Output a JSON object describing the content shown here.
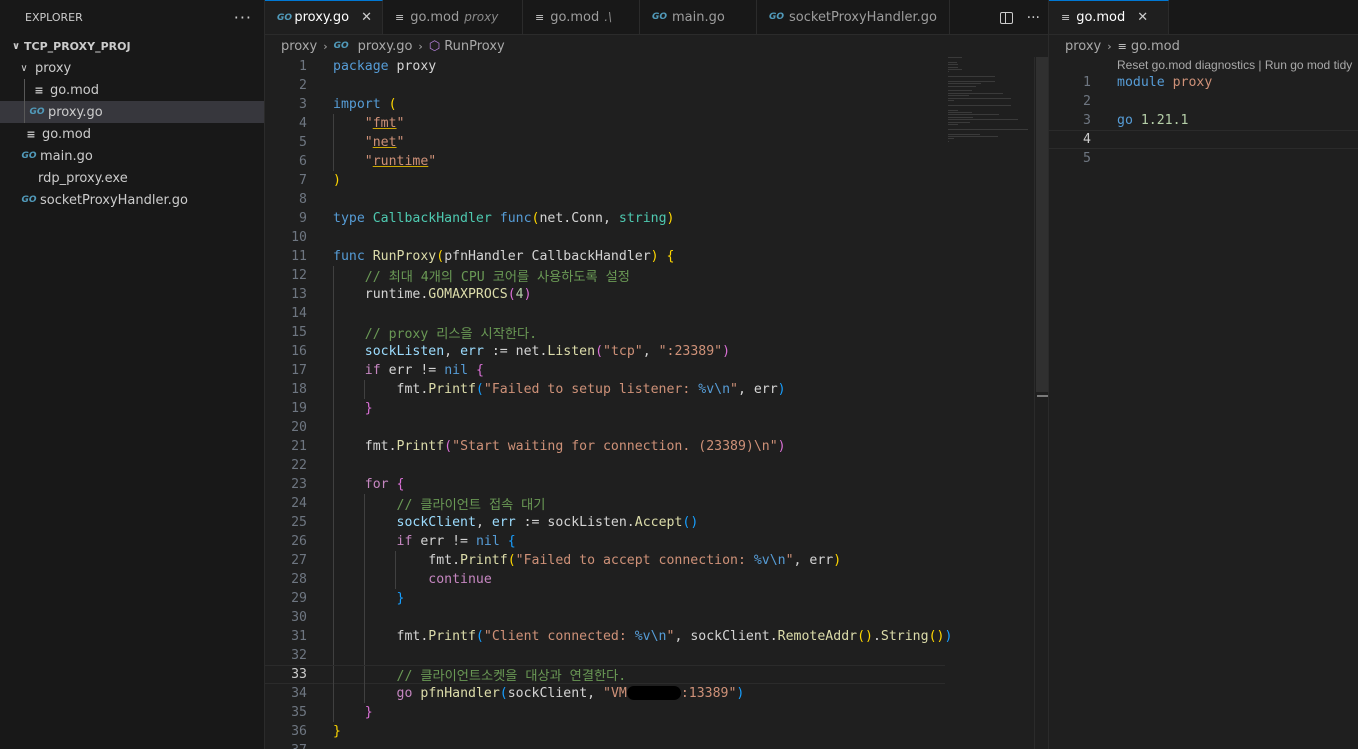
{
  "explorer": {
    "title": "EXPLORER",
    "more": "···",
    "root": "TCP_PROXY_PROJ",
    "items": [
      {
        "label": "proxy",
        "kind": "folder"
      },
      {
        "label": "go.mod",
        "kind": "mod"
      },
      {
        "label": "proxy.go",
        "kind": "go"
      },
      {
        "label": "go.mod",
        "kind": "mod"
      },
      {
        "label": "main.go",
        "kind": "go"
      },
      {
        "label": "rdp_proxy.exe",
        "kind": "exe"
      },
      {
        "label": "socketProxyHandler.go",
        "kind": "go"
      }
    ]
  },
  "tabs": [
    {
      "label": "proxy.go",
      "desc": "",
      "close": "✕"
    },
    {
      "label": "go.mod",
      "desc": "proxy"
    },
    {
      "label": "go.mod",
      "desc": ".\\"
    },
    {
      "label": "main.go",
      "desc": ""
    },
    {
      "label": "socketProxyHandler.go",
      "desc": ""
    }
  ],
  "tab_actions": {
    "more": "···"
  },
  "breadcrumb": {
    "folder": "proxy",
    "file": "proxy.go",
    "symbol": "RunProxy"
  },
  "icons": {
    "go": "GO",
    "lines": "≡",
    "chev_open": "∨",
    "chev_right": "›",
    "symbol": "⬡"
  },
  "current_line": 33,
  "code_lines": [
    [
      [
        "kw",
        "package"
      ],
      [
        "pl",
        " proxy"
      ]
    ],
    [],
    [
      [
        "kw",
        "import"
      ],
      [
        "pl",
        " "
      ],
      [
        "br1",
        "("
      ]
    ],
    [
      [
        "pl",
        "    "
      ],
      [
        "str",
        "\""
      ],
      [
        "str squig",
        "fmt"
      ],
      [
        "str",
        "\""
      ]
    ],
    [
      [
        "pl",
        "    "
      ],
      [
        "str",
        "\""
      ],
      [
        "str squig",
        "net"
      ],
      [
        "str",
        "\""
      ]
    ],
    [
      [
        "pl",
        "    "
      ],
      [
        "str",
        "\""
      ],
      [
        "str squig",
        "runtime"
      ],
      [
        "str",
        "\""
      ]
    ],
    [
      [
        "br1",
        ")"
      ]
    ],
    [],
    [
      [
        "kw",
        "type"
      ],
      [
        "pl",
        " "
      ],
      [
        "ty",
        "CallbackHandler"
      ],
      [
        "pl",
        " "
      ],
      [
        "kw",
        "func"
      ],
      [
        "br1",
        "("
      ],
      [
        "pl",
        "net.Conn, "
      ],
      [
        "ty",
        "string"
      ],
      [
        "br1",
        ")"
      ]
    ],
    [],
    [
      [
        "kw",
        "func"
      ],
      [
        "pl",
        " "
      ],
      [
        "fn",
        "RunProxy"
      ],
      [
        "br1",
        "("
      ],
      [
        "pl",
        "pfnHandler CallbackHandler"
      ],
      [
        "br1",
        ")"
      ],
      [
        "pl",
        " "
      ],
      [
        "br1",
        "{"
      ]
    ],
    [
      [
        "pl",
        "    "
      ],
      [
        "cm",
        "// 최대 4개의 CPU 코어를 사용하도록 설정"
      ]
    ],
    [
      [
        "pl",
        "    runtime."
      ],
      [
        "fn",
        "GOMAXPROCS"
      ],
      [
        "br2",
        "("
      ],
      [
        "num",
        "4"
      ],
      [
        "br2",
        ")"
      ]
    ],
    [],
    [
      [
        "pl",
        "    "
      ],
      [
        "cm",
        "// proxy 리스을 시작한다."
      ]
    ],
    [
      [
        "pl",
        "    "
      ],
      [
        "var",
        "sockListen"
      ],
      [
        "pl",
        ", "
      ],
      [
        "var",
        "err"
      ],
      [
        "pl",
        " := net."
      ],
      [
        "fn",
        "Listen"
      ],
      [
        "br2",
        "("
      ],
      [
        "str",
        "\"tcp\""
      ],
      [
        "pl",
        ", "
      ],
      [
        "str",
        "\":23389\""
      ],
      [
        "br2",
        ")"
      ]
    ],
    [
      [
        "pl",
        "    "
      ],
      [
        "kw2",
        "if"
      ],
      [
        "pl",
        " err != "
      ],
      [
        "kw",
        "nil"
      ],
      [
        "pl",
        " "
      ],
      [
        "br2",
        "{"
      ]
    ],
    [
      [
        "pl",
        "        fmt."
      ],
      [
        "fn",
        "Printf"
      ],
      [
        "br3",
        "("
      ],
      [
        "str",
        "\"Failed to setup listener: "
      ],
      [
        "fmtv",
        "%v\\n"
      ],
      [
        "str",
        "\""
      ],
      [
        "pl",
        ", err"
      ],
      [
        "br3",
        ")"
      ]
    ],
    [
      [
        "pl",
        "    "
      ],
      [
        "br2",
        "}"
      ]
    ],
    [],
    [
      [
        "pl",
        "    fmt."
      ],
      [
        "fn",
        "Printf"
      ],
      [
        "br2",
        "("
      ],
      [
        "str",
        "\"Start waiting for connection. (23389)\\n\""
      ],
      [
        "br2",
        ")"
      ]
    ],
    [],
    [
      [
        "pl",
        "    "
      ],
      [
        "kw2",
        "for"
      ],
      [
        "pl",
        " "
      ],
      [
        "br2",
        "{"
      ]
    ],
    [
      [
        "pl",
        "        "
      ],
      [
        "cm",
        "// 클라이언트 접속 대기"
      ]
    ],
    [
      [
        "pl",
        "        "
      ],
      [
        "var",
        "sockClient"
      ],
      [
        "pl",
        ", "
      ],
      [
        "var",
        "err"
      ],
      [
        "pl",
        " := sockListen."
      ],
      [
        "fn",
        "Accept"
      ],
      [
        "br3",
        "()"
      ]
    ],
    [
      [
        "pl",
        "        "
      ],
      [
        "kw2",
        "if"
      ],
      [
        "pl",
        " err != "
      ],
      [
        "kw",
        "nil"
      ],
      [
        "pl",
        " "
      ],
      [
        "br3",
        "{"
      ]
    ],
    [
      [
        "pl",
        "            fmt."
      ],
      [
        "fn",
        "Printf"
      ],
      [
        "br1",
        "("
      ],
      [
        "str",
        "\"Failed to accept connection: "
      ],
      [
        "fmtv",
        "%v\\n"
      ],
      [
        "str",
        "\""
      ],
      [
        "pl",
        ", err"
      ],
      [
        "br1",
        ")"
      ]
    ],
    [
      [
        "pl",
        "            "
      ],
      [
        "kw2",
        "continue"
      ]
    ],
    [
      [
        "pl",
        "        "
      ],
      [
        "br3",
        "}"
      ]
    ],
    [],
    [
      [
        "pl",
        "        fmt."
      ],
      [
        "fn",
        "Printf"
      ],
      [
        "br3",
        "("
      ],
      [
        "str",
        "\"Client connected: "
      ],
      [
        "fmtv",
        "%v\\n"
      ],
      [
        "str",
        "\""
      ],
      [
        "pl",
        ", sockClient."
      ],
      [
        "fn",
        "RemoteAddr"
      ],
      [
        "br1",
        "()"
      ],
      [
        "pl",
        "."
      ],
      [
        "fn",
        "String"
      ],
      [
        "br1",
        "()"
      ],
      [
        "br3",
        ")"
      ]
    ],
    [],
    [
      [
        "pl",
        "        "
      ],
      [
        "cm",
        "// 클라이언트소켓을 대상과 연결한다."
      ]
    ],
    [
      [
        "pl",
        "        "
      ],
      [
        "kw2",
        "go"
      ],
      [
        "pl",
        " "
      ],
      [
        "fn",
        "pfnHandler"
      ],
      [
        "br3",
        "("
      ],
      [
        "pl",
        "sockClient, "
      ],
      [
        "str",
        "\"VM"
      ],
      [
        "redact",
        ""
      ],
      [
        "str",
        ":13389\""
      ],
      [
        "br3",
        ")"
      ]
    ],
    [
      [
        "pl",
        "    "
      ],
      [
        "br2",
        "}"
      ]
    ],
    [
      [
        "br1",
        "}"
      ]
    ],
    []
  ],
  "indent_guides": [
    [],
    [],
    [],
    [
      1
    ],
    [
      1
    ],
    [
      1
    ],
    [],
    [],
    [],
    [],
    [],
    [
      1
    ],
    [
      1
    ],
    [
      1
    ],
    [
      1
    ],
    [
      1
    ],
    [
      1
    ],
    [
      1,
      2
    ],
    [
      1
    ],
    [
      1
    ],
    [
      1
    ],
    [
      1
    ],
    [
      1
    ],
    [
      1,
      2
    ],
    [
      1,
      2
    ],
    [
      1,
      2
    ],
    [
      1,
      2,
      3
    ],
    [
      1,
      2,
      3
    ],
    [
      1,
      2
    ],
    [
      1,
      2
    ],
    [
      1,
      2
    ],
    [
      1,
      2
    ],
    [
      1,
      2
    ],
    [
      1,
      2
    ],
    [
      1
    ],
    [],
    []
  ],
  "editor2": {
    "tab": {
      "label": "go.mod",
      "close": "✕"
    },
    "breadcrumb": {
      "folder": "proxy",
      "file": "go.mod"
    },
    "codelens": "Reset go.mod diagnostics | Run go mod tidy",
    "current_line": 4,
    "code_lines": [
      [
        [
          "kw",
          "module"
        ],
        [
          "pl",
          " "
        ],
        [
          "str",
          "proxy"
        ]
      ],
      [],
      [
        [
          "kw",
          "go"
        ],
        [
          "pl",
          " "
        ],
        [
          "num",
          "1.21.1"
        ]
      ],
      [],
      []
    ]
  }
}
